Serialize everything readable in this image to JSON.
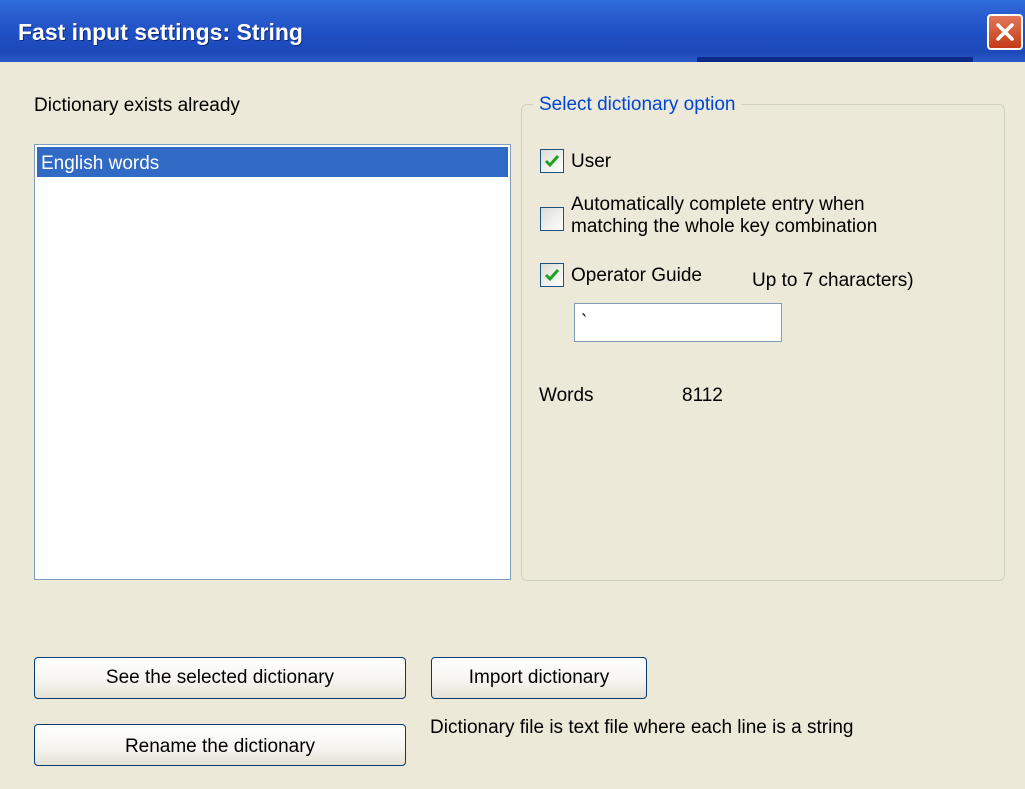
{
  "window": {
    "title": "Fast input settings: String"
  },
  "dictionary_list": {
    "label": "Dictionary exists already",
    "items": [
      "English words"
    ]
  },
  "options": {
    "group_label": "Select dictionary option",
    "user": {
      "label": "User",
      "checked": true
    },
    "auto_complete": {
      "label_line1": "Automatically complete entry when",
      "label_line2": "matching the whole key combination",
      "checked": false
    },
    "operator_guide": {
      "label": "Operator Guide",
      "checked": true,
      "hint": "Up to 7 characters)"
    },
    "guide_value": "`",
    "words_label": "Words",
    "words_count": "8112"
  },
  "buttons": {
    "see_selected": "See the selected dictionary",
    "import": "Import dictionary",
    "rename": "Rename the dictionary"
  },
  "note": "Dictionary file is text file where each line is a string"
}
